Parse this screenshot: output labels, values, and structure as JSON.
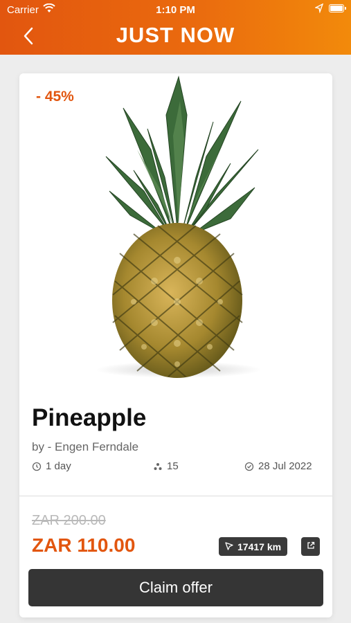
{
  "status_bar": {
    "carrier": "Carrier",
    "time": "1:10 PM"
  },
  "header": {
    "brand": "JUST NOW",
    "brand_color": "#e2560f"
  },
  "offer": {
    "discount": "- 45%",
    "title": "Pineapple",
    "vendor": "by - Engen Ferndale",
    "duration": "1 day",
    "quantity": "15",
    "date": "28 Jul 2022",
    "old_price": "ZAR 200.00",
    "new_price": "ZAR 110.00",
    "distance": "17417 km",
    "claim_label": "Claim offer"
  },
  "icons": [
    "back-chevron-icon",
    "wifi-icon",
    "location-arrow-icon",
    "battery-icon",
    "clock-icon",
    "stack-icon",
    "calendar-check-icon",
    "navigation-arrow-icon",
    "external-link-icon"
  ]
}
